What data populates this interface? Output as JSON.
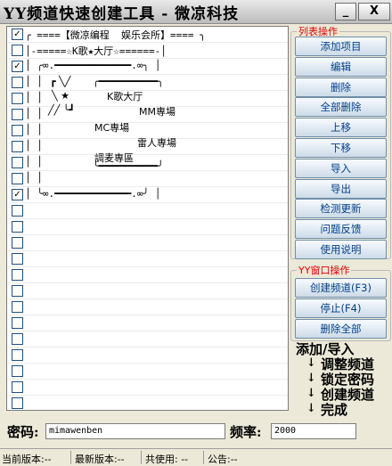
{
  "window": {
    "title": "YY频道快速创建工具 - 微凉科技",
    "min_glyph": "_",
    "close_glyph": "X"
  },
  "list": {
    "rows": [
      {
        "checked": true,
        "text": "╭ ====【微凉编程  娱乐会所】==== ╮"
      },
      {
        "checked": false,
        "text": "│-=====☆K歌★大厅☆======-│"
      },
      {
        "checked": true,
        "text": "│ ╭∞.━━━━━━━━━━━━━.∞╮ │"
      },
      {
        "checked": false,
        "text": "│ │"
      },
      {
        "checked": false,
        "text": "│ │"
      },
      {
        "checked": false,
        "text": "│ │"
      },
      {
        "checked": false,
        "text": "│ │"
      },
      {
        "checked": false,
        "text": "│ │"
      },
      {
        "checked": false,
        "text": "│ │"
      },
      {
        "checked": false,
        "text": "│ │"
      },
      {
        "checked": true,
        "text": "│ ╰∞.━━━━━━━━━━━━━.∞╯ │"
      },
      {
        "checked": false,
        "text": ""
      },
      {
        "checked": false,
        "text": ""
      },
      {
        "checked": false,
        "text": ""
      },
      {
        "checked": false,
        "text": ""
      },
      {
        "checked": false,
        "text": ""
      },
      {
        "checked": false,
        "text": ""
      },
      {
        "checked": false,
        "text": ""
      },
      {
        "checked": false,
        "text": ""
      },
      {
        "checked": false,
        "text": ""
      },
      {
        "checked": false,
        "text": ""
      },
      {
        "checked": false,
        "text": ""
      },
      {
        "checked": false,
        "text": ""
      },
      {
        "checked": false,
        "text": ""
      }
    ],
    "art": {
      "star_top": "┏ ╲╱",
      "star_mid": "╲ ★",
      "star_bot": "╱╱ ╰┛",
      "box_top": "╭━━━━━━━━━━╮",
      "box_bot": "╰━━━━━━━━━━╯",
      "line1": "K歌大厅",
      "line2": "MM専場",
      "line3": "MC専場",
      "line4": "雷人専場",
      "line5": "調麦専區"
    }
  },
  "list_ops": {
    "title": "列表操作",
    "buttons": [
      "添加项目",
      "编辑",
      "删除",
      "全部删除",
      "上移",
      "下移",
      "导入",
      "导出",
      "检测更新",
      "问题反馈",
      "使用说明"
    ]
  },
  "yy_ops": {
    "title": "YY窗口操作",
    "buttons": [
      "创建频道(F3)",
      "停止(F4)",
      "删除全部"
    ]
  },
  "steps": [
    "添加/导入",
    "调整频道",
    "锁定密码",
    "创建频道",
    "完成"
  ],
  "arrow": "↓",
  "form": {
    "password_label": "密码:",
    "password_value": "mimawenben",
    "rate_label": "频率:",
    "rate_value": "2000"
  },
  "status": {
    "current_version": "当前版本:--",
    "latest_version": "最新版本:--",
    "usage": "共使用: --",
    "notice": "公告:--"
  }
}
